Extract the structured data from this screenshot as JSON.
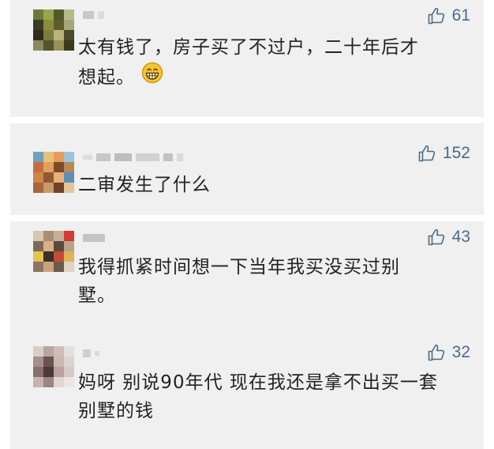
{
  "comments": [
    {
      "likes": "61",
      "line1": "太有钱了，房子买了不过户，二十年后才",
      "line2": "想起。",
      "emoji": "grinning-face-emoji"
    },
    {
      "likes": "152",
      "line1": "二审发生了什么"
    },
    {
      "likes": "43",
      "line1": "我得抓紧时间想一下当年我买没买过别",
      "line2": "墅。"
    },
    {
      "likes": "32",
      "line1": "妈呀 别说90年代 现在我还是拿不出买一套",
      "line2": "别墅的钱"
    }
  ],
  "icons": {
    "like": "thumbs-up-icon"
  },
  "colors": {
    "card_background": "#f0f0f0",
    "text": "#222222",
    "like_accent": "#4a6b8a"
  }
}
